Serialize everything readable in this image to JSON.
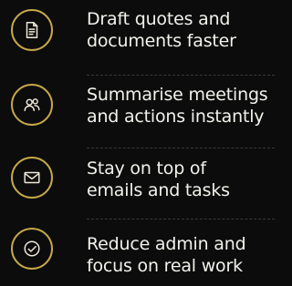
{
  "features": [
    {
      "icon": "document-icon",
      "line1": "Draft quotes and",
      "line2": "documents faster"
    },
    {
      "icon": "people-icon",
      "line1": "Summarise meetings",
      "line2": "and actions instantly"
    },
    {
      "icon": "envelope-icon",
      "line1": "Stay on top of",
      "line2": "emails and tasks"
    },
    {
      "icon": "checkmark-icon",
      "line1": "Reduce admin and",
      "line2": "focus on real work"
    }
  ],
  "colors": {
    "background": "#0b0c0b",
    "accent_ring": "#c6a74a",
    "text": "#f2f1ec",
    "divider": "#3a3a36"
  }
}
